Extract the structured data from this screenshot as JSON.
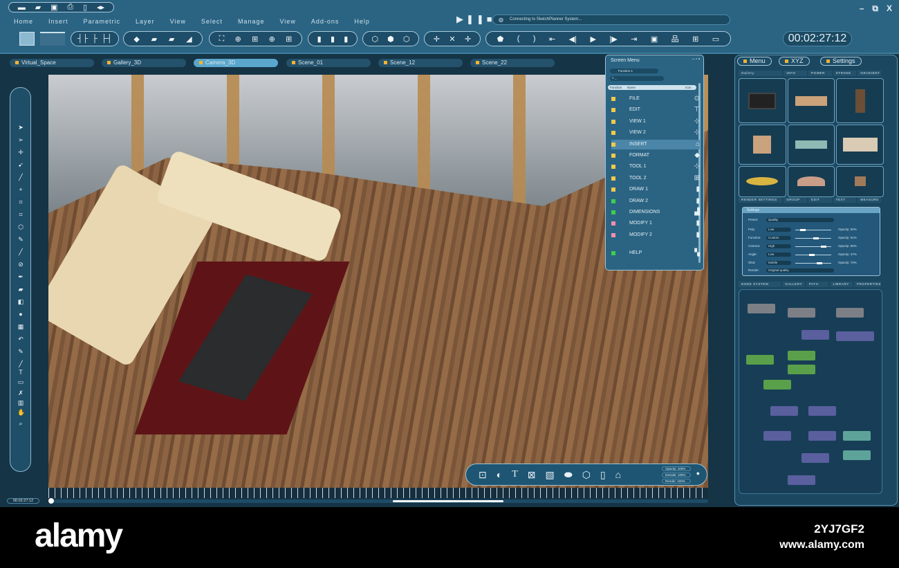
{
  "quick_tools": [
    "new-icon",
    "open-icon",
    "save-icon",
    "print-icon",
    "mobile-icon",
    "split-icon"
  ],
  "menu": [
    "Home",
    "Insert",
    "Parametric",
    "Layer",
    "View",
    "Select",
    "Manage",
    "View",
    "Add-ons",
    "Help"
  ],
  "status": "Connecting to SketchPlanner System...",
  "timer": "00:02:27:12",
  "timeline_time": "00:02:27:12",
  "timeline_progress": 0.0,
  "tabs": [
    "Virtual_Space",
    "Gallery_3D",
    "Camera_3D",
    "Scene_01",
    "Scene_12",
    "Scene_22"
  ],
  "active_tab": "Camera_3D",
  "right_tabs": [
    "Menu",
    "XYZ",
    "Settings"
  ],
  "gallery_bar": [
    "Gallery",
    "INFO",
    "POWER",
    "STROKE",
    "GRADIENT"
  ],
  "render_bar": [
    "RENDER SETTINGS",
    "GROUP",
    "EDIT",
    "TEXT",
    "MEASURE"
  ],
  "node_bar": [
    "NODE SYSTEM",
    "GALLERY",
    "PATH",
    "LIBRARY",
    "PROPERTIES"
  ],
  "screen_menu": {
    "title": "Screen Menu",
    "function_select": "Function 1",
    "headers": [
      "Function",
      "Name",
      "Icon"
    ],
    "items": [
      {
        "name": "FILE",
        "color": "#f2c94c"
      },
      {
        "name": "EDIT",
        "color": "#f2c94c"
      },
      {
        "name": "VIEW 1",
        "color": "#f2c94c"
      },
      {
        "name": "VIEW 2",
        "color": "#f2c94c"
      },
      {
        "name": "INSERT",
        "color": "#f2c94c"
      },
      {
        "name": "FORMAT",
        "color": "#f2c94c"
      },
      {
        "name": "TOOL 1",
        "color": "#f2c94c"
      },
      {
        "name": "TOOL 2",
        "color": "#f2c94c"
      },
      {
        "name": "DRAW 1",
        "color": "#f2c94c"
      },
      {
        "name": "DRAW 2",
        "color": "#3ccf4e"
      },
      {
        "name": "DIMENSIONS",
        "color": "#3ccf4e"
      },
      {
        "name": "MODIFY 1",
        "color": "#f28fb0"
      },
      {
        "name": "MODIFY 2",
        "color": "#f28fb0"
      },
      {
        "name": "HELP",
        "color": "#3ccf4e"
      }
    ]
  },
  "settings": {
    "title": "Settings",
    "preset": {
      "label": "Preset:",
      "value": "Quality"
    },
    "rows": [
      {
        "label": "Poly:",
        "value": "Low",
        "slider": 0.15,
        "opacity": "Opacity: 90%"
      },
      {
        "label": "Function:",
        "value": "Custom",
        "slider": 0.6,
        "opacity": "Opacity: 61%"
      },
      {
        "label": "Camera:",
        "value": "High",
        "slider": 0.85,
        "opacity": "Opacity: 80%"
      },
      {
        "label": "Angle:",
        "value": "Low",
        "slider": 0.45,
        "opacity": "Opacity: 47%"
      },
      {
        "label": "Shot:",
        "value": "Mobile",
        "slider": 0.7,
        "opacity": "Opacity: 72%"
      }
    ],
    "render": {
      "label": "Render:",
      "value": "Original quality"
    }
  },
  "bottom_toolbar": {
    "opacity": "Opacity: 100%",
    "extrude": "Extrude: 100%",
    "render": "Render: 100%"
  },
  "watermark": {
    "brand": "alamy",
    "id": "2YJ7GF2",
    "url": "www.alamy.com"
  }
}
